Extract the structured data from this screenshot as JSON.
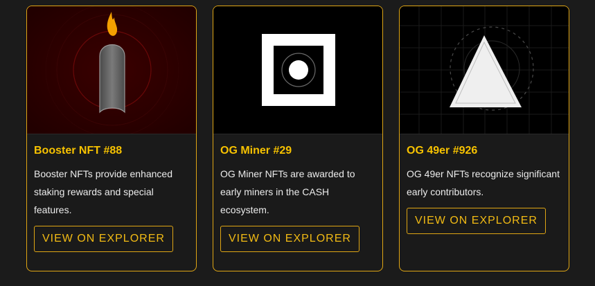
{
  "cards": [
    {
      "title": "Booster NFT #88",
      "description": "Booster NFTs provide enhanced staking rewards and special features.",
      "button_label": "VIEW ON EXPLORER",
      "image_icon": "booster-flame-icon",
      "colors": {
        "bg": "#2a0000",
        "accent": "#f4a000"
      }
    },
    {
      "title": "OG Miner #29",
      "description": "OG Miner NFTs are awarded to early miners in the CASH ecosystem.",
      "button_label": "VIEW ON EXPLORER",
      "image_icon": "square-target-icon",
      "colors": {
        "bg": "#000000",
        "accent": "#ffffff"
      }
    },
    {
      "title": "OG 49er #926",
      "description": "OG 49er NFTs recognize significant early contributors.",
      "button_label": "VIEW ON EXPLORER",
      "image_icon": "triangle-icon",
      "colors": {
        "bg": "#000000",
        "accent": "#ededed"
      }
    }
  ],
  "colors": {
    "page_bg": "#1b1b1b",
    "card_border": "#e0a614",
    "title": "#f7c200",
    "text": "#ececec"
  }
}
